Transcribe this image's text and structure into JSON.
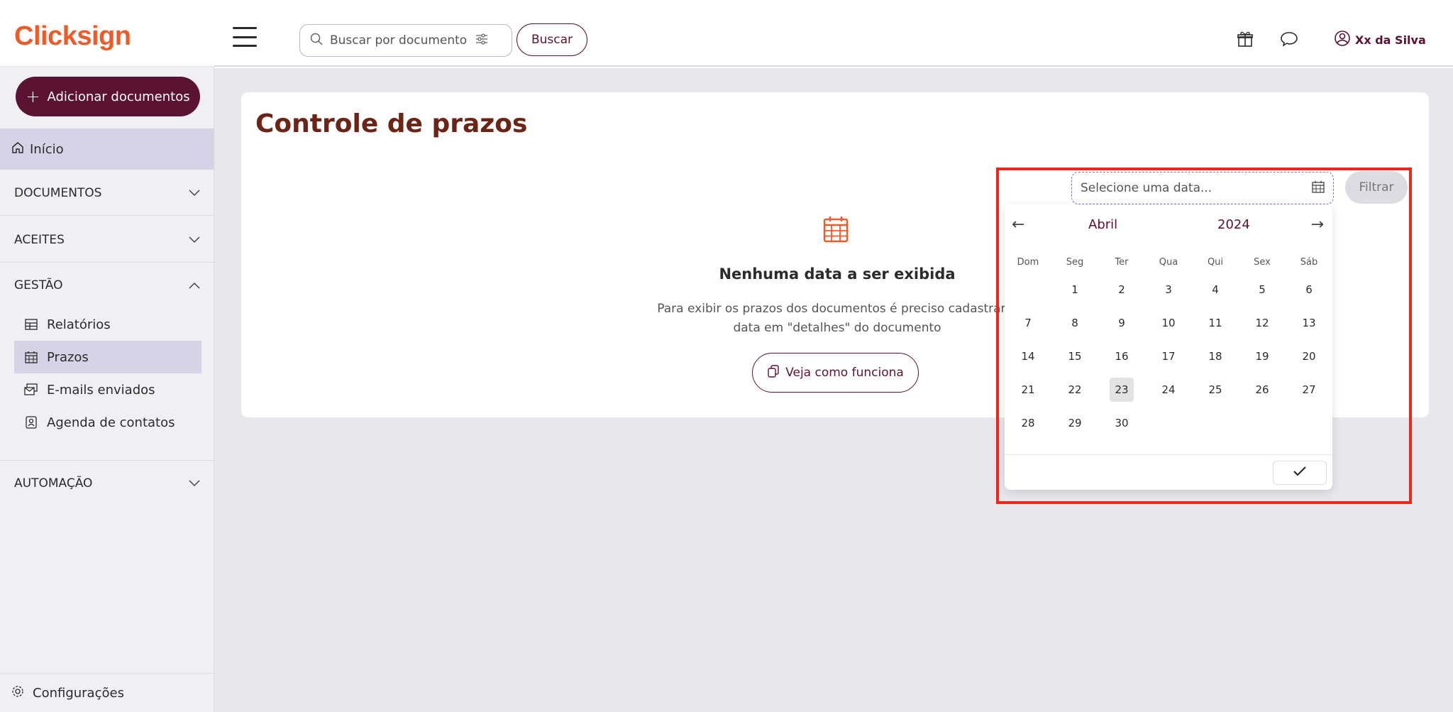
{
  "brand": {
    "logo": "Clicksign",
    "logo_color": "#f05a28",
    "accent": "#5c1232"
  },
  "header": {
    "search_placeholder": "Buscar por documento",
    "search_button": "Buscar",
    "user_name": "Xx da Silva",
    "icons": [
      "menu-icon",
      "search-icon",
      "filter-icon",
      "gift-icon",
      "chat-icon",
      "user-icon"
    ]
  },
  "sidebar": {
    "add_button": "Adicionar documentos",
    "home": "Início",
    "sections": {
      "documentos": "DOCUMENTOS",
      "aceites": "ACEITES",
      "gestao": "GESTÃO",
      "automacao": "AUTOMAÇÃO"
    },
    "gestao_items": [
      {
        "label": "Relatórios",
        "icon": "table-icon"
      },
      {
        "label": "Prazos",
        "icon": "calendar-icon",
        "active": true
      },
      {
        "label": "E-mails enviados",
        "icon": "mail-icon"
      },
      {
        "label": "Agenda de contatos",
        "icon": "contact-icon"
      }
    ],
    "config": "Configurações"
  },
  "main": {
    "title": "Controle de prazos",
    "empty_title": "Nenhuma data a ser exibida",
    "empty_text_line1": "Para exibir os prazos dos documentos é preciso cadastrar u",
    "empty_text_line2": "data em \"detalhes\" do documento",
    "help_button": "Veja como funciona"
  },
  "filter": {
    "date_placeholder": "Selecione uma data...",
    "filter_button": "Filtrar"
  },
  "calendar": {
    "month": "Abril",
    "year": "2024",
    "weekdays": [
      "Dom",
      "Seg",
      "Ter",
      "Qua",
      "Qui",
      "Sex",
      "Sáb"
    ],
    "weeks": [
      [
        "",
        "1",
        "2",
        "3",
        "4",
        "5",
        "6"
      ],
      [
        "7",
        "8",
        "9",
        "10",
        "11",
        "12",
        "13"
      ],
      [
        "14",
        "15",
        "16",
        "17",
        "18",
        "19",
        "20"
      ],
      [
        "21",
        "22",
        "23",
        "24",
        "25",
        "26",
        "27"
      ],
      [
        "28",
        "29",
        "30",
        "",
        "",
        "",
        ""
      ]
    ],
    "today": "23"
  }
}
